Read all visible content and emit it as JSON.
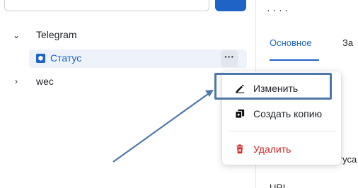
{
  "top": {
    "dots": "·   ·   ·   ·"
  },
  "tree": {
    "items": [
      {
        "label": "Telegram",
        "chevron": "⌄"
      },
      {
        "label": "Статус"
      },
      {
        "label": "wec",
        "chevron": "›"
      }
    ],
    "more_label": "···"
  },
  "tabs": [
    {
      "label": "Основное"
    },
    {
      "label": "За"
    }
  ],
  "right_panel": {
    "partial_1": "тусa",
    "partial_2": "URL"
  },
  "context_menu": {
    "items": [
      {
        "label": "Изменить",
        "icon": "pencil-icon"
      },
      {
        "label": "Создать копию",
        "icon": "copy-icon"
      },
      {
        "label": "Удалить",
        "icon": "trash-icon",
        "color": "#d12424"
      }
    ]
  },
  "colors": {
    "accent": "#1f63c6",
    "highlight_border": "#4e77a8",
    "danger": "#d12424"
  }
}
